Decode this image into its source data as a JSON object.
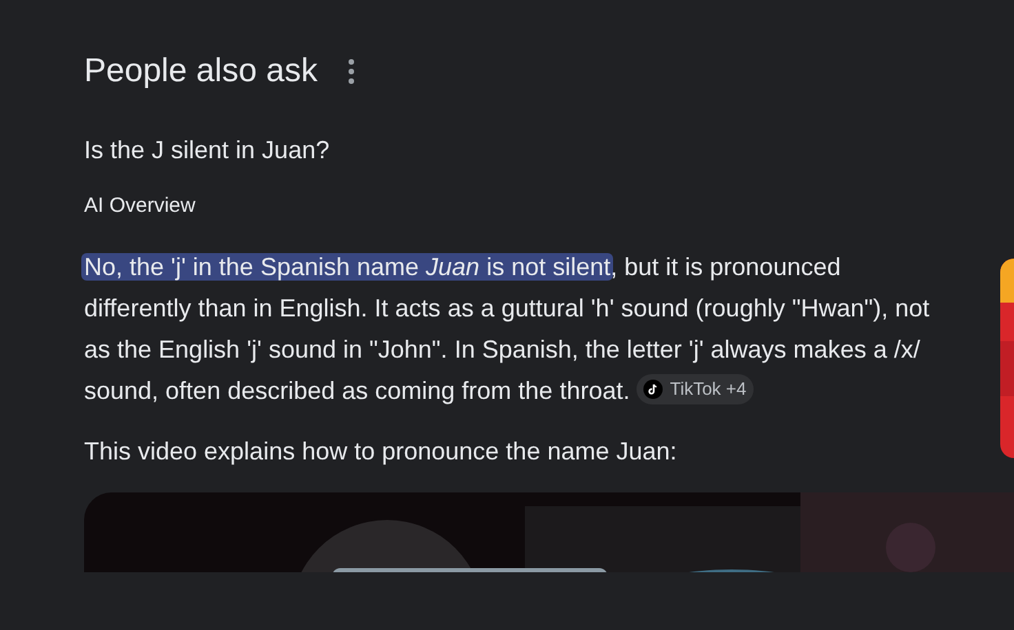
{
  "section": {
    "title": "People also ask"
  },
  "question": "Is the J silent in Juan?",
  "overview": {
    "label": "AI Overview",
    "highlight": "No, the 'j' in the Spanish name *Juan* is not silent",
    "text": ", but it is pronounced differently than in English. It acts as a guttural 'h' sound (roughly \"Hwan\"), not as the English 'j' sound in \"John\". In Spanish, the letter 'j' always makes a /x/ sound, often described as coming from the throat.",
    "source_chip": "TikTok +4"
  },
  "video_intro": "This video explains how to pronounce the name Juan:"
}
